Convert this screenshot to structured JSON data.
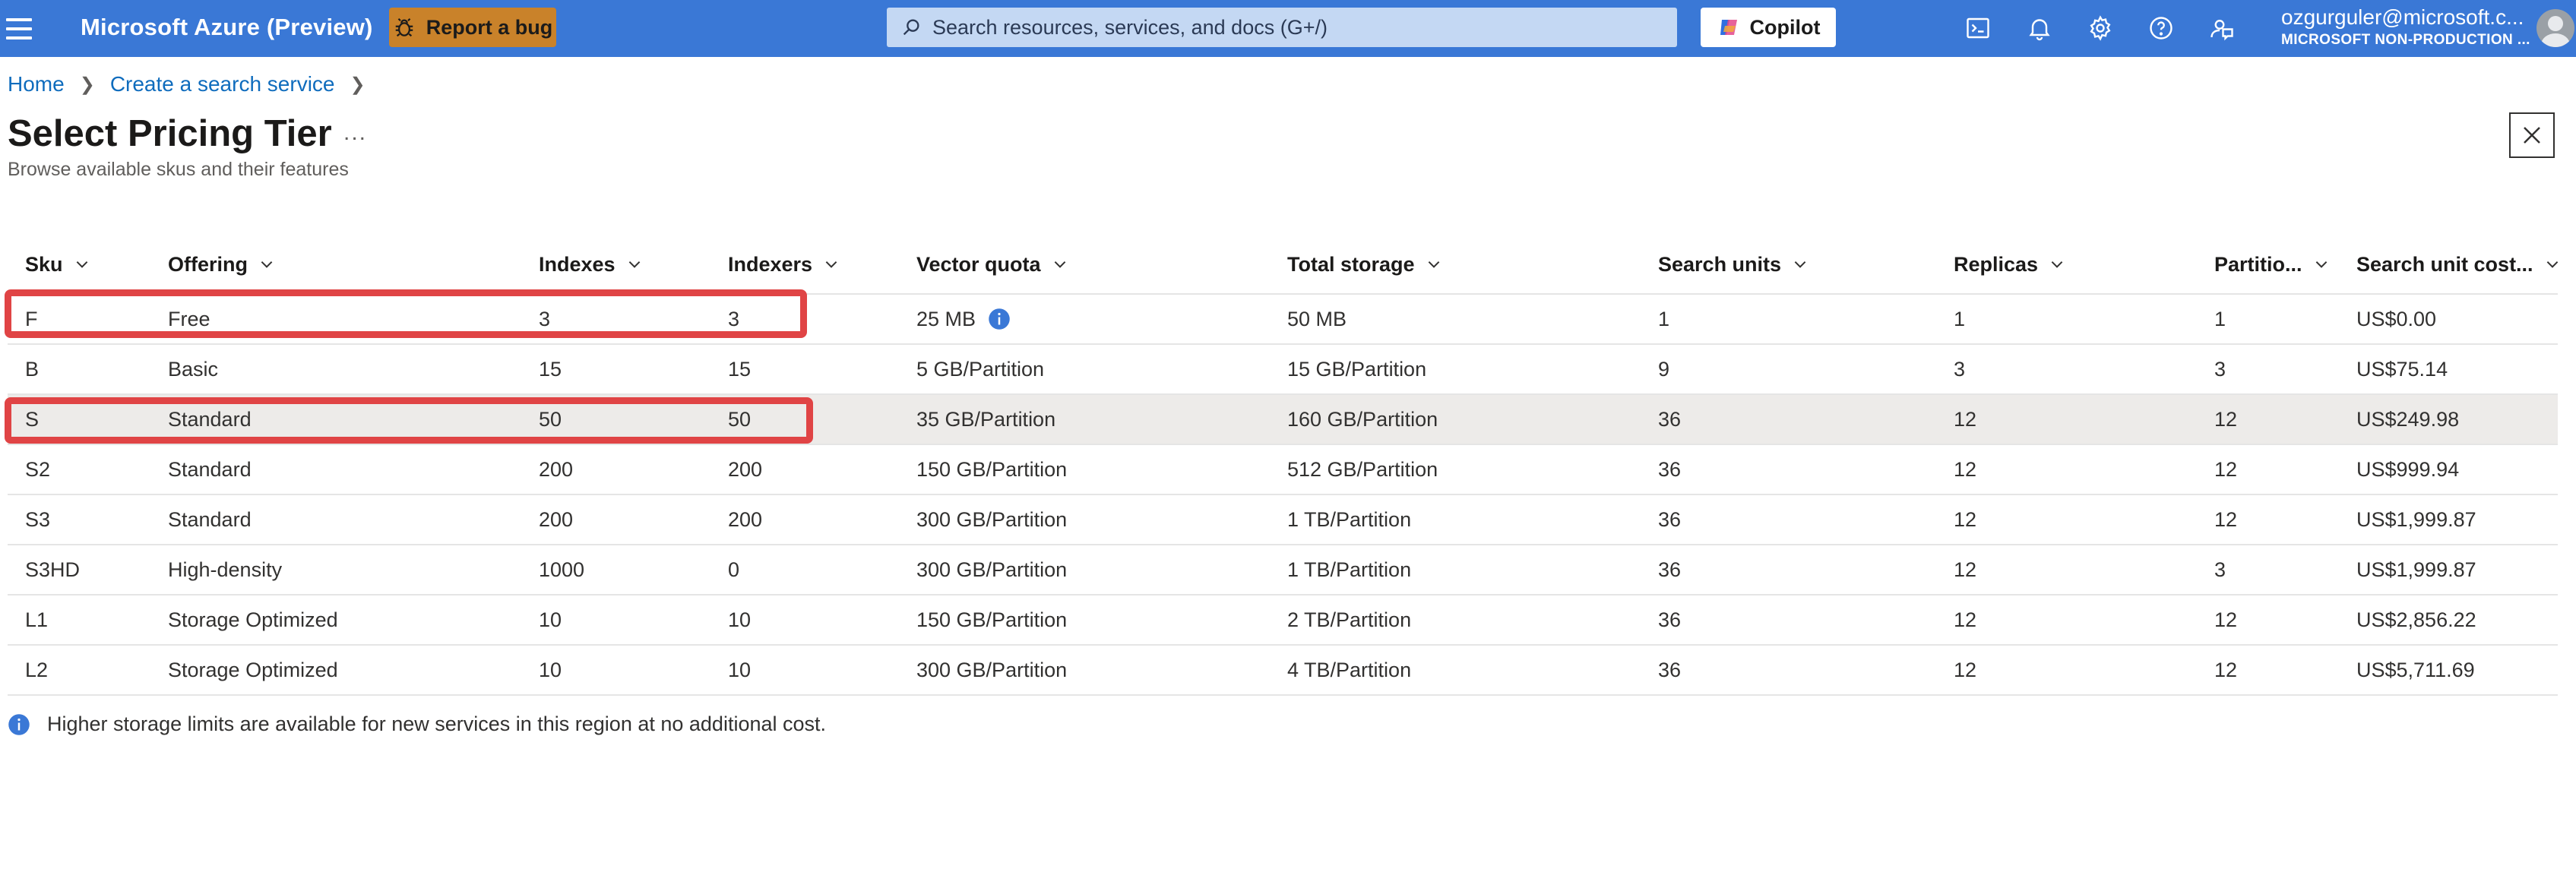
{
  "topbar": {
    "brand": "Microsoft Azure (Preview)",
    "report_bug_label": "Report a bug",
    "search_placeholder": "Search resources, services, and docs (G+/)",
    "copilot_label": "Copilot",
    "icons": [
      "cloud-shell-icon",
      "bell-icon",
      "gear-icon",
      "help-icon",
      "feedback-icon"
    ],
    "account_email": "ozgurguler@microsoft.c...",
    "account_tenant": "MICROSOFT NON-PRODUCTION ..."
  },
  "breadcrumb": {
    "items": [
      "Home",
      "Create a search service"
    ]
  },
  "page": {
    "title": "Select Pricing Tier",
    "more": "...",
    "subtitle": "Browse available skus and their features"
  },
  "table": {
    "columns": [
      "Sku",
      "Offering",
      "Indexes",
      "Indexers",
      "Vector quota",
      "Total storage",
      "Search units",
      "Replicas",
      "Partitio...",
      "Search unit cost..."
    ],
    "rows": [
      {
        "sku": "F",
        "offering": "Free",
        "indexes": "3",
        "indexers": "3",
        "vector_quota": "25 MB",
        "total_storage": "50 MB",
        "search_units": "1",
        "replicas": "1",
        "partitions": "1",
        "cost": "US$0.00"
      },
      {
        "sku": "B",
        "offering": "Basic",
        "indexes": "15",
        "indexers": "15",
        "vector_quota": "5 GB/Partition",
        "total_storage": "15 GB/Partition",
        "search_units": "9",
        "replicas": "3",
        "partitions": "3",
        "cost": "US$75.14"
      },
      {
        "sku": "S",
        "offering": "Standard",
        "indexes": "50",
        "indexers": "50",
        "vector_quota": "35 GB/Partition",
        "total_storage": "160 GB/Partition",
        "search_units": "36",
        "replicas": "12",
        "partitions": "12",
        "cost": "US$249.98"
      },
      {
        "sku": "S2",
        "offering": "Standard",
        "indexes": "200",
        "indexers": "200",
        "vector_quota": "150 GB/Partition",
        "total_storage": "512 GB/Partition",
        "search_units": "36",
        "replicas": "12",
        "partitions": "12",
        "cost": "US$999.94"
      },
      {
        "sku": "S3",
        "offering": "Standard",
        "indexes": "200",
        "indexers": "200",
        "vector_quota": "300 GB/Partition",
        "total_storage": "1 TB/Partition",
        "search_units": "36",
        "replicas": "12",
        "partitions": "12",
        "cost": "US$1,999.87"
      },
      {
        "sku": "S3HD",
        "offering": "High-density",
        "indexes": "1000",
        "indexers": "0",
        "vector_quota": "300 GB/Partition",
        "total_storage": "1 TB/Partition",
        "search_units": "36",
        "replicas": "12",
        "partitions": "3",
        "cost": "US$1,999.87"
      },
      {
        "sku": "L1",
        "offering": "Storage Optimized",
        "indexes": "10",
        "indexers": "10",
        "vector_quota": "150 GB/Partition",
        "total_storage": "2 TB/Partition",
        "search_units": "36",
        "replicas": "12",
        "partitions": "12",
        "cost": "US$2,856.22"
      },
      {
        "sku": "L2",
        "offering": "Storage Optimized",
        "indexes": "10",
        "indexers": "10",
        "vector_quota": "300 GB/Partition",
        "total_storage": "4 TB/Partition",
        "search_units": "36",
        "replicas": "12",
        "partitions": "12",
        "cost": "US$5,711.69"
      }
    ],
    "selected_sku": "S",
    "highlighted_skus": [
      "F",
      "S"
    ]
  },
  "note": "Higher storage limits are available for new services in this region at no additional cost.",
  "colors": {
    "topbar": "#3a78d6",
    "report_bug": "#c9822a",
    "highlight": "#e04445",
    "link": "#0f6cbd",
    "info": "#3a78d6",
    "selected_row": "#edebe9"
  }
}
